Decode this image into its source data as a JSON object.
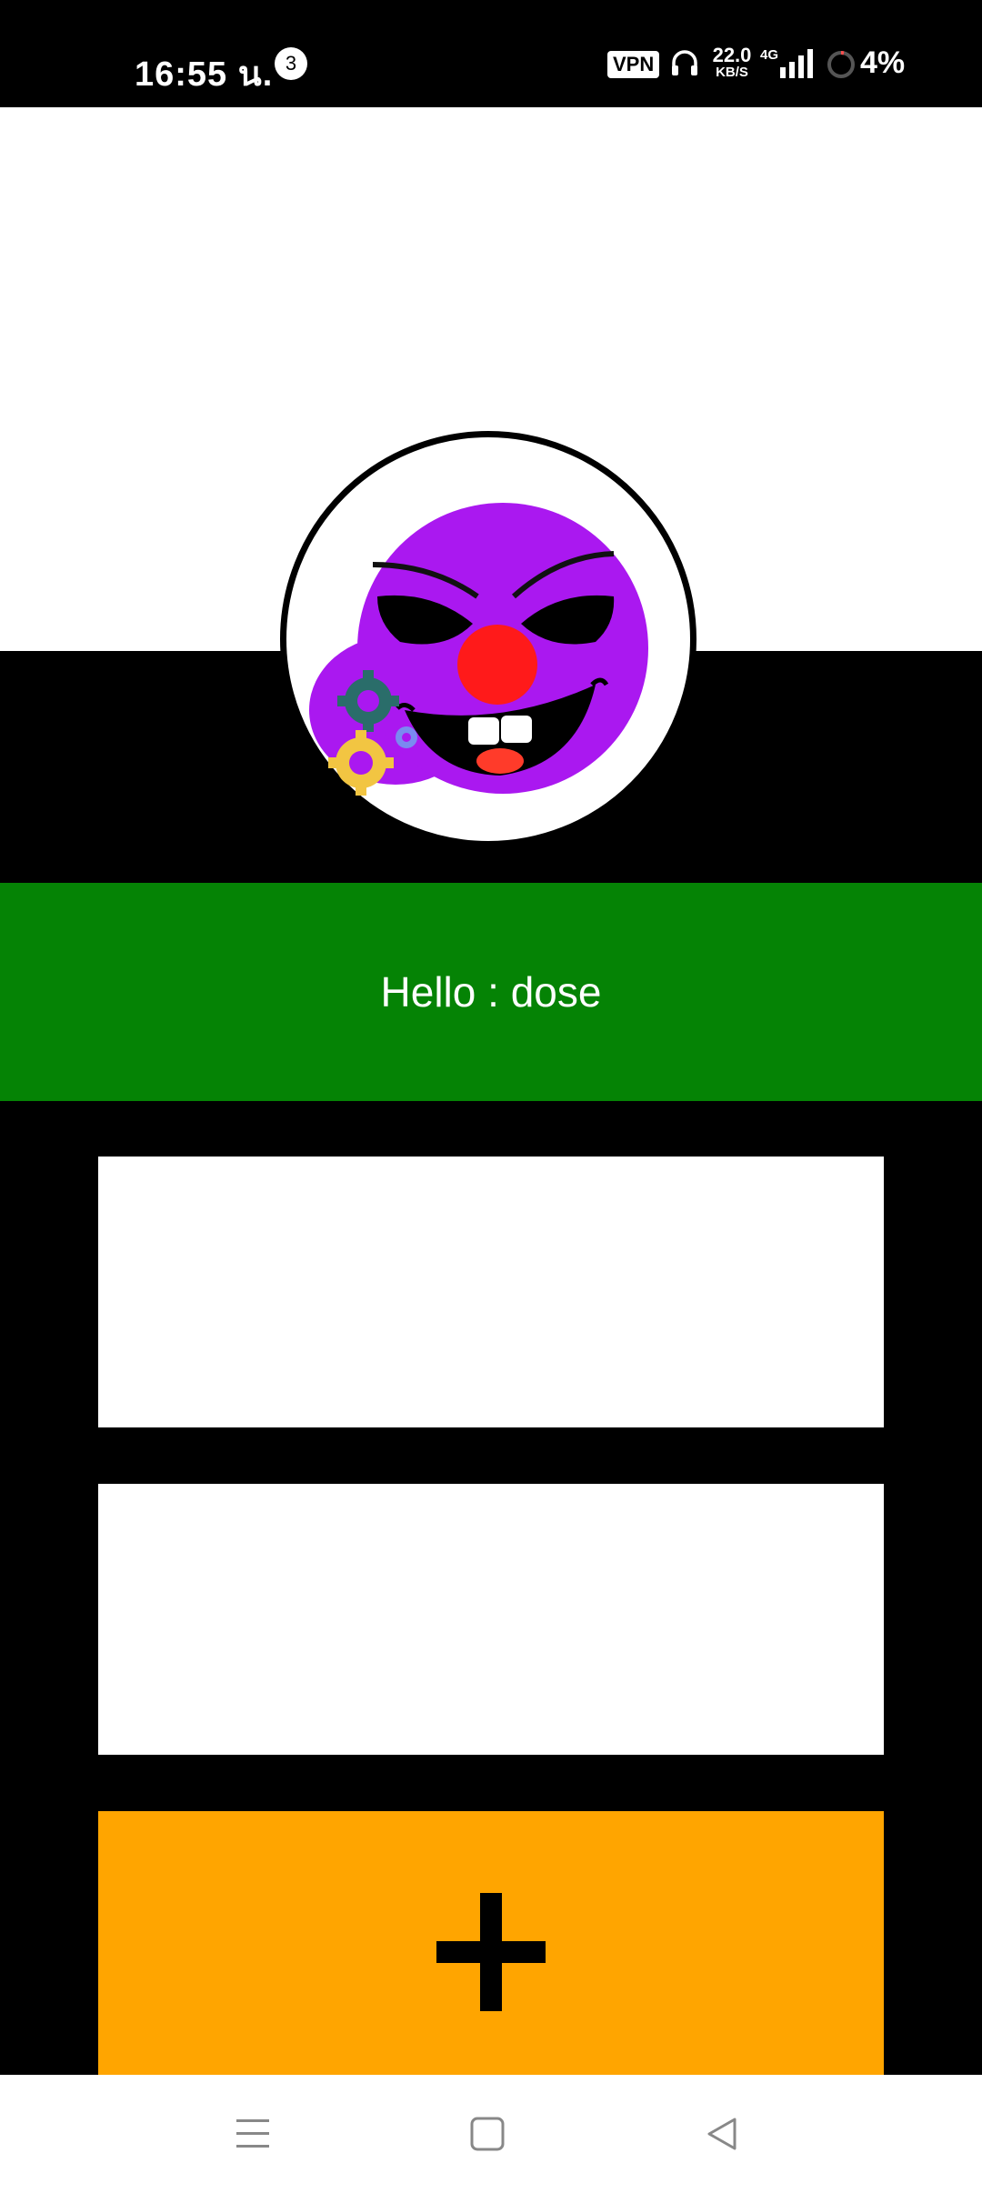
{
  "status_bar": {
    "time": "16:55 น.",
    "notification_count": "3",
    "vpn_label": "VPN",
    "net_speed_value": "22.0",
    "net_speed_unit": "KB/S",
    "network_type": "4G",
    "battery": "4%",
    "icons": [
      "headphone-icon",
      "signal-icon",
      "battery-ring-icon"
    ]
  },
  "profile": {
    "avatar_icon": "purple-clown-face-icon"
  },
  "greeting": {
    "text": "Hello : dose"
  },
  "add_button": {
    "icon": "plus-icon"
  },
  "nav_bar": {
    "icons": [
      "menu-icon",
      "home-icon",
      "back-icon"
    ]
  },
  "colors": {
    "banner": "#058305",
    "add_button": "#ffa500",
    "avatar_face": "#aa18f0",
    "clown_nose": "#ff1a1a"
  }
}
